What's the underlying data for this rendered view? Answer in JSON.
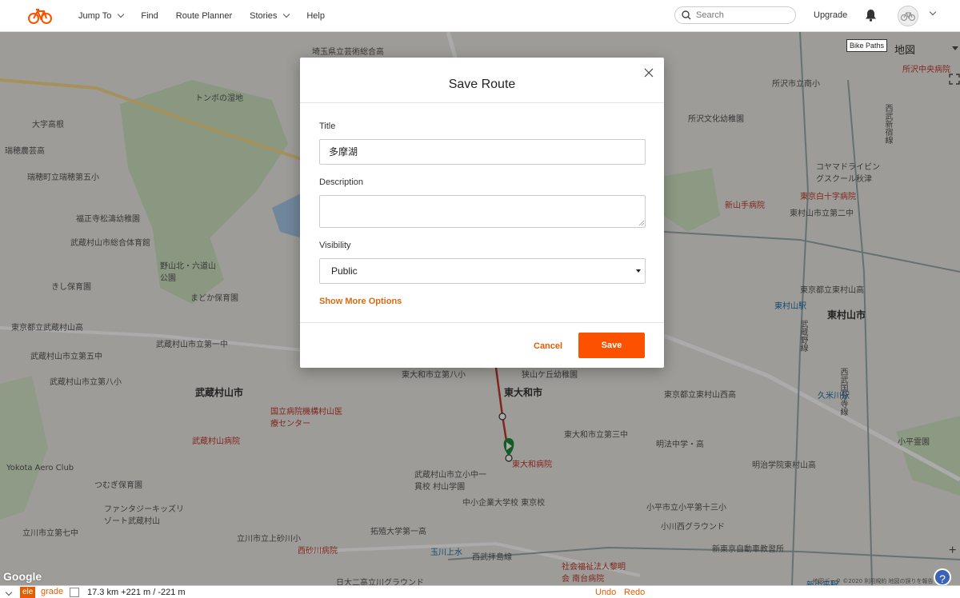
{
  "nav": {
    "items": [
      {
        "label": "Jump To",
        "has_menu": true
      },
      {
        "label": "Find",
        "has_menu": false
      },
      {
        "label": "Route Planner",
        "has_menu": false
      },
      {
        "label": "Stories",
        "has_menu": true
      },
      {
        "label": "Help",
        "has_menu": false
      }
    ],
    "search_placeholder": "Search",
    "upgrade_label": "Upgrade",
    "accent": "#fc5200"
  },
  "map": {
    "bike_paths_label": "Bike Paths",
    "map_type": "地図",
    "google": "Google",
    "attribution": "地図データ ©2020   利用規約   地図の誤りを報告",
    "labels": [
      {
        "text": "埼玉県立芸術総合高",
        "style": ""
      },
      {
        "text": "トンボの湿地",
        "style": ""
      },
      {
        "text": "大字高根",
        "style": ""
      },
      {
        "text": "瑞穂農芸高",
        "style": ""
      },
      {
        "text": "瑞穂町立瑞穂第五小",
        "style": ""
      },
      {
        "text": "福正寺松濤幼稚園",
        "style": ""
      },
      {
        "text": "武蔵村山市総合体育館",
        "style": ""
      },
      {
        "text": "野山北・六道山公園",
        "style": ""
      },
      {
        "text": "きし保育園",
        "style": ""
      },
      {
        "text": "まどか保育園",
        "style": ""
      },
      {
        "text": "東京都立武蔵村山高",
        "style": ""
      },
      {
        "text": "武蔵村山市立第一中",
        "style": ""
      },
      {
        "text": "武蔵村山市立第五中",
        "style": ""
      },
      {
        "text": "武蔵村山市立第八小",
        "style": ""
      },
      {
        "text": "武蔵村山市",
        "style": "big"
      },
      {
        "text": "国立病院機構村山医療センター",
        "style": "red"
      },
      {
        "text": "武蔵村山病院",
        "style": "red"
      },
      {
        "text": "Yokota Aero Club",
        "style": ""
      },
      {
        "text": "つむぎ保育園",
        "style": ""
      },
      {
        "text": "ファンタジーキッズリゾート武蔵村山",
        "style": ""
      },
      {
        "text": "立川市立第七中",
        "style": ""
      },
      {
        "text": "立川市立上砂川小",
        "style": ""
      },
      {
        "text": "西砂川病院",
        "style": "red"
      },
      {
        "text": "拓殖大学第一高",
        "style": ""
      },
      {
        "text": "日大二高立川グラウンド",
        "style": ""
      },
      {
        "text": "武蔵村山市立小中一貫校 村山学園",
        "style": ""
      },
      {
        "text": "中小企業大学校 東京校",
        "style": ""
      },
      {
        "text": "東大和市",
        "style": "big"
      },
      {
        "text": "東大和病院",
        "style": "red"
      },
      {
        "text": "東大和市立第三中",
        "style": ""
      },
      {
        "text": "明法中学・高",
        "style": ""
      },
      {
        "text": "明治学院東村山高",
        "style": ""
      },
      {
        "text": "小平市立小平第十三小",
        "style": ""
      },
      {
        "text": "小川西グラウンド",
        "style": ""
      },
      {
        "text": "新東京自動車教習所",
        "style": ""
      },
      {
        "text": "社会福祉法人黎明会 南台病院",
        "style": "red"
      },
      {
        "text": "所沢市立南小",
        "style": ""
      },
      {
        "text": "所沢文化幼稚園",
        "style": ""
      },
      {
        "text": "コヤマドライビングスクール秋津",
        "style": ""
      },
      {
        "text": "東京白十字病院",
        "style": "red"
      },
      {
        "text": "新山手病院",
        "style": "red"
      },
      {
        "text": "東村山市立第二中",
        "style": ""
      },
      {
        "text": "東村山市",
        "style": "big"
      },
      {
        "text": "東京都立東村山高",
        "style": ""
      },
      {
        "text": "久米川駅",
        "style": "blue"
      },
      {
        "text": "東村山駅",
        "style": "blue"
      },
      {
        "text": "新小平駅",
        "style": "blue"
      },
      {
        "text": "小平霊園",
        "style": ""
      },
      {
        "text": "東京都立東村山西高",
        "style": ""
      },
      {
        "text": "東大和市立第八小",
        "style": ""
      },
      {
        "text": "狭山ケ丘幼稚園",
        "style": ""
      },
      {
        "text": "所沢中央病院",
        "style": "red"
      },
      {
        "text": "西武拝島線",
        "style": ""
      },
      {
        "text": "西武新宿線",
        "style": ""
      },
      {
        "text": "西武国分寺線",
        "style": ""
      },
      {
        "text": "武蔵野線",
        "style": ""
      },
      {
        "text": "玉川上水",
        "style": "blue"
      }
    ]
  },
  "bottom_bar": {
    "ele_label": "ele",
    "grade_label": "grade",
    "stats": "17.3 km +221 m / -221 m",
    "undo_label": "Undo",
    "redo_label": "Redo"
  },
  "modal": {
    "title": "Save Route",
    "title_label": "Title",
    "title_value": "多摩湖",
    "description_label": "Description",
    "description_value": "",
    "visibility_label": "Visibility",
    "visibility_value": "Public",
    "more_options_label": "Show More Options",
    "cancel_label": "Cancel",
    "save_label": "Save"
  }
}
